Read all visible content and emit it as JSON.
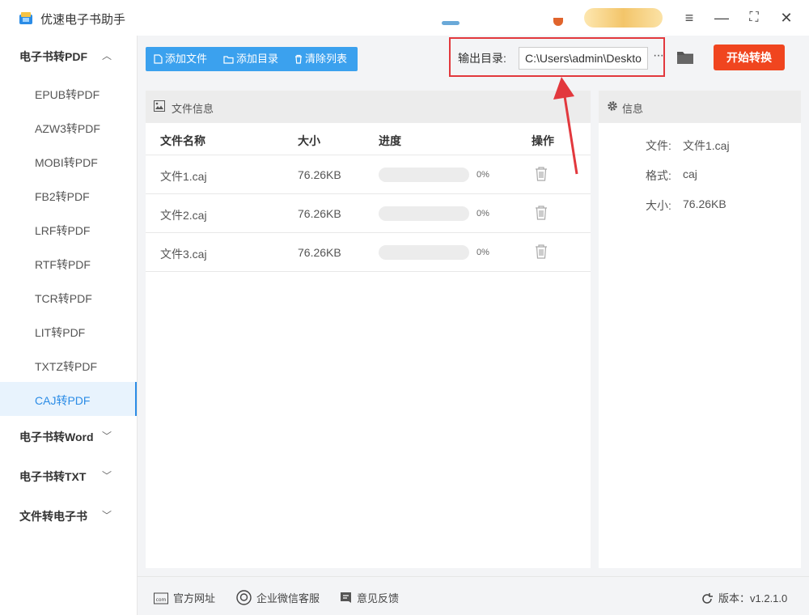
{
  "app": {
    "title": "优速电子书助手"
  },
  "window_controls": {
    "menu": "≡",
    "minimize": "—",
    "maximize": "⛶",
    "close": "✕"
  },
  "sidebar": {
    "groups": [
      {
        "label": "电子书转PDF",
        "chevron": "^",
        "expanded": true
      },
      {
        "label": "电子书转Word",
        "chevron": "v"
      },
      {
        "label": "电子书转TXT",
        "chevron": "v"
      },
      {
        "label": "文件转电子书",
        "chevron": "v"
      }
    ],
    "items": [
      {
        "label": "EPUB转PDF"
      },
      {
        "label": "AZW3转PDF"
      },
      {
        "label": "MOBI转PDF"
      },
      {
        "label": "FB2转PDF"
      },
      {
        "label": "LRF转PDF"
      },
      {
        "label": "RTF转PDF"
      },
      {
        "label": "TCR转PDF"
      },
      {
        "label": "LIT转PDF"
      },
      {
        "label": "TXTZ转PDF"
      },
      {
        "label": "CAJ转PDF",
        "active": true
      }
    ]
  },
  "toolbar": {
    "add_file": "添加文件",
    "add_dir": "添加目录",
    "clear_list": "清除列表",
    "output_label": "输出目录:",
    "output_value": "C:\\Users\\admin\\Deskto",
    "more": "···",
    "start": "开始转换"
  },
  "file_panel": {
    "title": "文件信息",
    "columns": {
      "name": "文件名称",
      "size": "大小",
      "progress": "进度",
      "action": "操作"
    },
    "rows": [
      {
        "name": "文件1.caj",
        "size": "76.26KB",
        "progress": 0,
        "pct": "0%"
      },
      {
        "name": "文件2.caj",
        "size": "76.26KB",
        "progress": 0,
        "pct": "0%"
      },
      {
        "name": "文件3.caj",
        "size": "76.26KB",
        "progress": 0,
        "pct": "0%"
      }
    ]
  },
  "info_panel": {
    "title": "信息",
    "file_label": "文件:",
    "file_value": "文件1.caj",
    "format_label": "格式:",
    "format_value": "caj",
    "size_label": "大小:",
    "size_value": "76.26KB"
  },
  "statusbar": {
    "website": "官方网址",
    "wechat": "企业微信客服",
    "feedback": "意见反馈",
    "version": "版本：v1.2.1.0"
  },
  "colors": {
    "accent": "#3ba1ee",
    "start": "#f0451f",
    "highlight": "#e2383d"
  }
}
